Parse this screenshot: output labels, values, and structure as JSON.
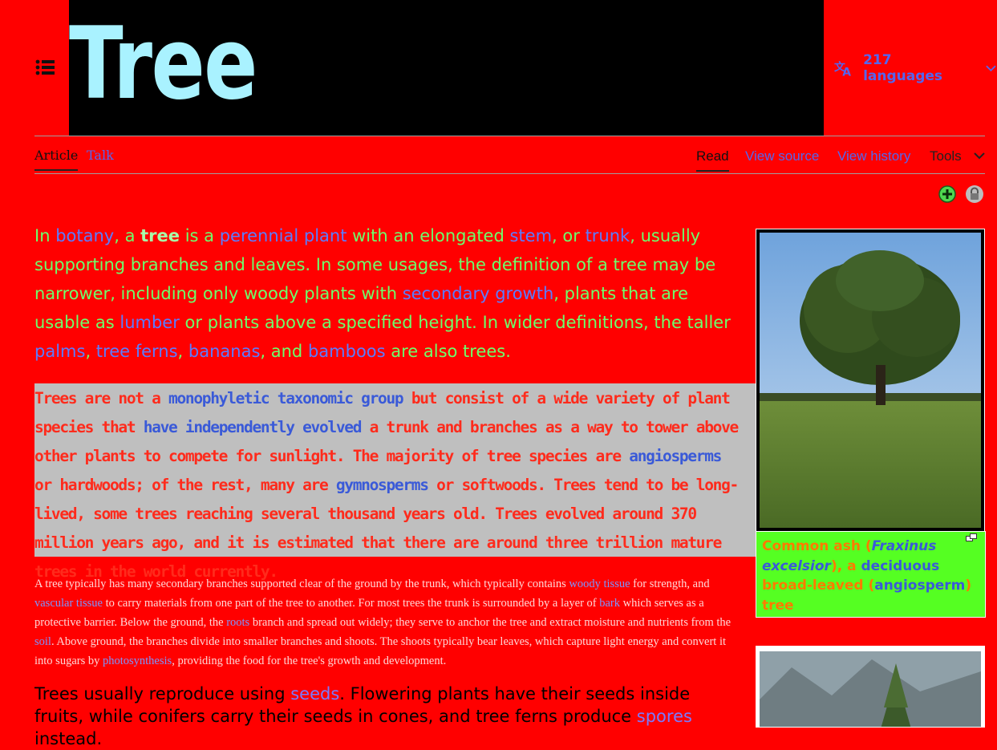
{
  "header": {
    "title": "Tree",
    "languages_label": "217 languages"
  },
  "tabs": {
    "article": "Article",
    "talk": "Talk",
    "read": "Read",
    "view_source": "View source",
    "view_history": "View history",
    "tools": "Tools"
  },
  "lead": {
    "p1": [
      {
        "t": "In "
      },
      {
        "a": "botany"
      },
      {
        "t": ", a "
      },
      {
        "b": "tree"
      },
      {
        "t": " is a "
      },
      {
        "a": "perennial plant"
      },
      {
        "t": " with an elongated "
      },
      {
        "a": "stem"
      },
      {
        "t": ", or "
      },
      {
        "a": "trunk"
      },
      {
        "t": ", usually supporting branches and leaves. In some usages, the definition of a tree may be narrower, including only woody plants with "
      },
      {
        "a": "secondary growth"
      },
      {
        "t": ", plants that are usable as "
      },
      {
        "a": "lumber"
      },
      {
        "t": " or plants above a specified height. In wider definitions, the taller "
      },
      {
        "a": "palms"
      },
      {
        "t": ", "
      },
      {
        "a": "tree ferns"
      },
      {
        "t": ", "
      },
      {
        "a": "bananas"
      },
      {
        "t": ", and "
      },
      {
        "a": "bamboos"
      },
      {
        "t": " are also trees."
      }
    ],
    "p2": [
      {
        "t": "Trees are not a "
      },
      {
        "a": "monophyletic taxonomic group"
      },
      {
        "t": " but consist of a wide variety of plant species that "
      },
      {
        "a": "have independently evolved"
      },
      {
        "t": " a trunk and branches as a way to tower above other plants to compete for sunlight. The majority of tree species are "
      },
      {
        "a": "angiosperms"
      },
      {
        "t": " or hardwoods; of the rest, many are "
      },
      {
        "a": "gymnosperms"
      },
      {
        "t": " or softwoods. Trees tend to be long-lived, some trees reaching several thousand years old. Trees evolved around 370 million years ago, and it is estimated that there are around three trillion mature trees in the world currently."
      }
    ],
    "p3": [
      {
        "t": "A tree typically has many secondary branches supported clear of the ground by the trunk, which typically contains "
      },
      {
        "a": "woody tissue"
      },
      {
        "t": " for strength, and "
      },
      {
        "a": "vascular tissue"
      },
      {
        "t": " to carry materials from one part of the tree to another. For most trees the trunk is surrounded by a layer of "
      },
      {
        "a": "bark"
      },
      {
        "t": " which serves as a protective barrier. Below the ground, the "
      },
      {
        "a": "roots"
      },
      {
        "t": " branch and spread out widely; they serve to anchor the tree and extract moisture and nutrients from the "
      },
      {
        "a": "soil"
      },
      {
        "t": ". Above ground, the branches divide into smaller branches and shoots. The shoots typically bear leaves, which capture light energy and convert it into sugars by "
      },
      {
        "a": "photosynthesis"
      },
      {
        "t": ", providing the food for the tree's growth and development."
      }
    ],
    "p4": [
      {
        "t": "Trees usually reproduce using "
      },
      {
        "a": "seeds"
      },
      {
        "t": ". Flowering plants have their seeds inside fruits, while conifers carry their seeds in cones, and tree ferns produce "
      },
      {
        "a": "spores"
      },
      {
        "t": " instead."
      }
    ]
  },
  "infobox": {
    "caption": [
      {
        "t": "Common ash ("
      },
      {
        "i": "Fraxinus excelsior"
      },
      {
        "t": "), a "
      },
      {
        "x": "deciduous"
      },
      {
        "t": " broad-leaved ("
      },
      {
        "a": "angiosperm"
      },
      {
        "t": ") tree"
      }
    ]
  },
  "icons": [
    "menu-icon",
    "translate-icon",
    "chevron-down-icon",
    "add-icon",
    "lock-icon",
    "expand-icon"
  ],
  "colors": {
    "page_bg": "#ff0000",
    "title_box": "#000000",
    "title_text": "#a9f2ff",
    "link": "#5566ee",
    "lead_text": "#6cff6c",
    "highlight_box": "#bfbfbf",
    "caption_bg": "#55ff22"
  }
}
